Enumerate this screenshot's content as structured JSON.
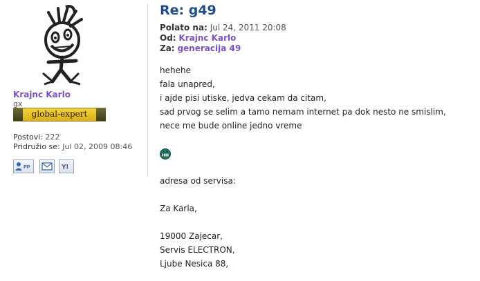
{
  "author": {
    "name": "Krajnc Karlo",
    "usertitle": "gx",
    "rank": "global-expert",
    "posts_label": "Postovi:",
    "posts_value": "222",
    "joined_label": "Pridružio se:",
    "joined_value": "Jul 02, 2009 08:46"
  },
  "contact_icons": [
    "profile-icon",
    "email-icon",
    "yahoo-icon"
  ],
  "profile_button_text": "PP",
  "yahoo_button_text": "Y!",
  "post": {
    "title": "Re: g49",
    "posted_label": "Polato na:",
    "posted_value": "Jul 24, 2011 20:08",
    "from_label": "Od:",
    "from_value": "Krajnc Karlo",
    "to_label": "Za:",
    "to_value": "generacija 49",
    "lines": [
      "hehehe",
      "fala unapred,",
      "i ajde pisi utiske, jedva cekam da citam,",
      "sad prvog se selim a tamo nemam internet pa dok nesto ne smislim,",
      "nece me bude online jedno vreme",
      "",
      "",
      "",
      "adresa od servisa:",
      "",
      "Za Karla,",
      "",
      "19000 Zajecar,",
      "Servis ELECTRON,",
      "Ljube Nesica 88,"
    ],
    "smiley_icon": "grin-smiley-icon"
  },
  "colors": {
    "title": "#1f4e8c",
    "link": "#7a52c7"
  }
}
